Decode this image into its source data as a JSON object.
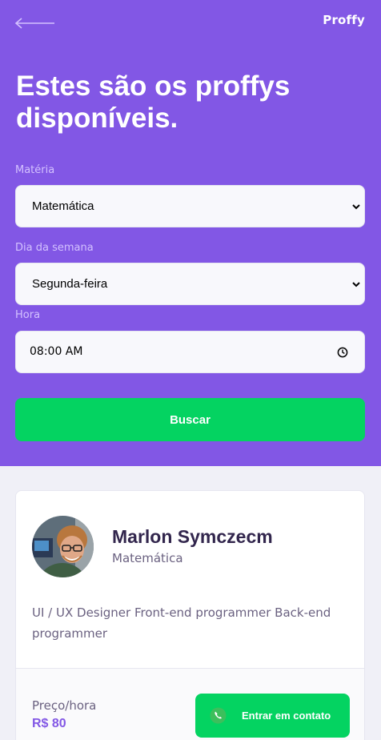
{
  "header": {
    "logo": "Proffy",
    "title": "Estes são os proffys disponíveis."
  },
  "filters": {
    "subject": {
      "label": "Matéria",
      "value": "Matemática"
    },
    "weekday": {
      "label": "Dia da semana",
      "value": "Segunda-feira"
    },
    "time": {
      "label": "Hora",
      "value": "08:00 AM"
    },
    "search_label": "Buscar"
  },
  "teacher": {
    "name": "Marlon Symczecm",
    "subject": "Matemática",
    "bio": "UI / UX Designer Front-end programmer Back-end programmer",
    "price_label": "Preço/hora",
    "price": "R$ 80",
    "contact_label": "Entrar em contato"
  },
  "colors": {
    "primary": "#8257E5",
    "secondary": "#04D361",
    "background": "#F0F0F7"
  },
  "icons": [
    "arrow-left-icon",
    "chevron-down-icon",
    "clock-icon",
    "whatsapp-icon"
  ]
}
